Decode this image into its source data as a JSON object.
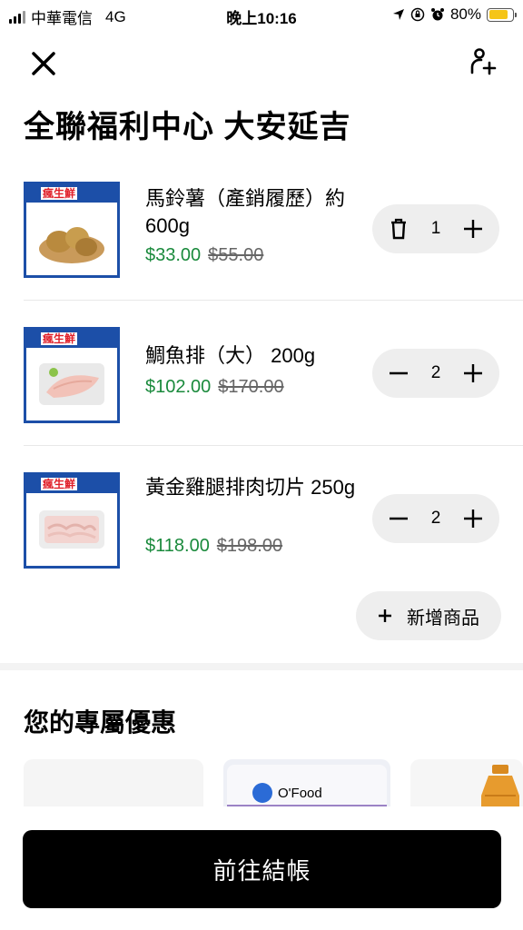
{
  "status_bar": {
    "carrier": "中華電信",
    "network": "4G",
    "time": "晚上10:16",
    "battery": "80%",
    "battery_level": 0.8
  },
  "header": {
    "close_icon": "close-icon",
    "add_user_icon": "add-user-icon",
    "store_name": "全聯福利中心 大安延吉"
  },
  "cart": {
    "items": [
      {
        "name": "馬鈴薯（產銷履歷）約600g",
        "price": "$33.00",
        "original_price": "$55.00",
        "quantity": "1",
        "left_control": "trash-icon",
        "badge_text": "瘋生鮮"
      },
      {
        "name": "鯛魚排（大） 200g",
        "price": "$102.00",
        "original_price": "$170.00",
        "quantity": "2",
        "left_control": "minus-icon",
        "badge_text": "瘋生鮮"
      },
      {
        "name": "黃金雞腿排肉切片 250g",
        "price": "$118.00",
        "original_price": "$198.00",
        "quantity": "2",
        "left_control": "minus-icon",
        "badge_text": "瘋生鮮"
      }
    ],
    "add_item_label": "新增商品"
  },
  "offers": {
    "title": "您的專屬優惠",
    "cards": [
      {
        "brand": ""
      },
      {
        "brand": "O'Food"
      },
      {
        "brand": ""
      }
    ]
  },
  "checkout": {
    "label": "前往結帳"
  },
  "colors": {
    "price_green": "#1a8a3c",
    "badge_blue": "#1c4fa8",
    "battery_yellow": "#f5c518",
    "checkout_black": "#000000"
  }
}
